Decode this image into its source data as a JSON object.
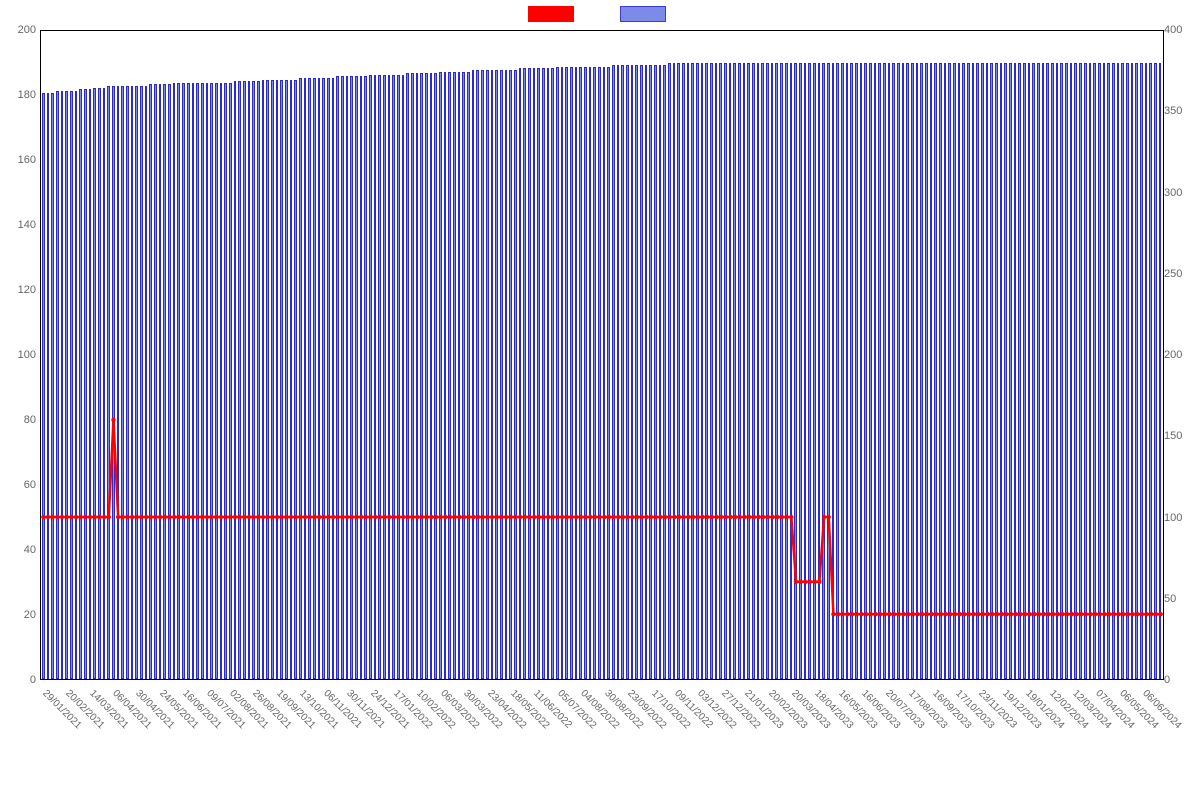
{
  "chart_data": {
    "type": "bar+line",
    "title": "",
    "xlabel": "",
    "y_left": {
      "label": "",
      "lim": [
        0,
        200
      ],
      "ticks": [
        0,
        20,
        40,
        60,
        80,
        100,
        120,
        140,
        160,
        180,
        200
      ]
    },
    "y_right": {
      "label": "",
      "lim": [
        0,
        400
      ],
      "ticks": [
        0,
        50,
        100,
        150,
        200,
        250,
        300,
        350,
        400
      ]
    },
    "x_tick_labels": [
      "29/01/2021",
      "20/02/2021",
      "14/03/2021",
      "06/04/2021",
      "30/04/2021",
      "24/05/2021",
      "16/06/2021",
      "09/07/2021",
      "02/08/2021",
      "26/08/2021",
      "19/09/2021",
      "13/10/2021",
      "06/11/2021",
      "30/11/2021",
      "24/12/2021",
      "17/01/2022",
      "10/02/2022",
      "06/03/2022",
      "30/03/2022",
      "23/04/2022",
      "18/05/2022",
      "11/06/2022",
      "05/07/2022",
      "04/08/2022",
      "30/08/2022",
      "23/09/2022",
      "17/10/2022",
      "09/11/2022",
      "03/12/2022",
      "27/12/2022",
      "21/01/2023",
      "20/02/2023",
      "20/03/2023",
      "18/04/2023",
      "16/05/2023",
      "16/06/2023",
      "20/07/2023",
      "17/08/2023",
      "16/09/2023",
      "17/10/2023",
      "23/11/2023",
      "19/12/2023",
      "19/01/2024",
      "12/02/2024",
      "12/03/2024",
      "07/04/2024",
      "06/05/2024",
      "06/06/2024"
    ],
    "series": [
      {
        "name": "",
        "axis": "left",
        "style": "line",
        "color": "#ff0000",
        "marker_every": 1,
        "values": [
          50,
          50,
          50,
          50,
          50,
          50,
          50,
          50,
          50,
          50,
          50,
          50,
          50,
          50,
          50,
          80,
          50,
          50,
          50,
          50,
          50,
          50,
          50,
          50,
          50,
          50,
          50,
          50,
          50,
          50,
          50,
          50,
          50,
          50,
          50,
          50,
          50,
          50,
          50,
          50,
          50,
          50,
          50,
          50,
          50,
          50,
          50,
          50,
          50,
          50,
          50,
          50,
          50,
          50,
          50,
          50,
          50,
          50,
          50,
          50,
          50,
          50,
          50,
          50,
          50,
          50,
          50,
          50,
          50,
          50,
          50,
          50,
          50,
          50,
          50,
          50,
          50,
          50,
          50,
          50,
          50,
          50,
          50,
          50,
          50,
          50,
          50,
          50,
          50,
          50,
          50,
          50,
          50,
          50,
          50,
          50,
          50,
          50,
          50,
          50,
          50,
          50,
          50,
          50,
          50,
          50,
          50,
          50,
          50,
          50,
          50,
          50,
          50,
          50,
          50,
          50,
          50,
          50,
          50,
          50,
          50,
          50,
          50,
          50,
          50,
          50,
          50,
          50,
          50,
          50,
          50,
          50,
          50,
          50,
          50,
          50,
          50,
          50,
          50,
          50,
          50,
          50,
          50,
          50,
          50,
          50,
          50,
          50,
          50,
          50,
          50,
          50,
          50,
          50,
          50,
          50,
          50,
          50,
          50,
          50,
          50,
          30,
          30,
          30,
          30,
          30,
          30,
          50,
          50,
          20,
          20,
          20,
          20,
          20,
          20,
          20,
          20,
          20,
          20,
          20,
          20,
          20,
          20,
          20,
          20,
          20,
          20,
          20,
          20,
          20,
          20,
          20,
          20,
          20,
          20,
          20,
          20,
          20,
          20,
          20,
          20,
          20,
          20,
          20,
          20,
          20,
          20,
          20,
          20,
          20,
          20,
          20,
          20,
          20,
          20,
          20,
          20,
          20,
          20,
          20,
          20,
          20,
          20,
          20,
          20,
          20,
          20,
          20,
          20,
          20,
          20,
          20,
          20,
          20,
          20,
          20,
          20,
          20,
          20,
          20
        ]
      },
      {
        "name": "",
        "axis": "right",
        "style": "bar",
        "color": "#7b8be6",
        "values": [
          362,
          362,
          362,
          363,
          363,
          363,
          363,
          363,
          364,
          364,
          364,
          365,
          365,
          365,
          366,
          366,
          366,
          366,
          366,
          366,
          366,
          366,
          366,
          367,
          367,
          367,
          367,
          367,
          368,
          368,
          368,
          368,
          368,
          368,
          368,
          368,
          368,
          368,
          368,
          368,
          368,
          369,
          369,
          369,
          369,
          369,
          369,
          370,
          370,
          370,
          370,
          370,
          370,
          370,
          370,
          371,
          371,
          371,
          371,
          371,
          371,
          371,
          371,
          372,
          372,
          372,
          372,
          372,
          372,
          372,
          373,
          373,
          373,
          373,
          373,
          373,
          373,
          373,
          374,
          374,
          374,
          374,
          374,
          374,
          374,
          375,
          375,
          375,
          375,
          375,
          375,
          375,
          376,
          376,
          376,
          376,
          376,
          376,
          376,
          376,
          376,
          376,
          377,
          377,
          377,
          377,
          377,
          377,
          377,
          377,
          378,
          378,
          378,
          378,
          378,
          378,
          378,
          378,
          378,
          378,
          378,
          378,
          379,
          379,
          379,
          379,
          379,
          379,
          379,
          379,
          379,
          379,
          379,
          379,
          380,
          380,
          380,
          380,
          380,
          380,
          380,
          380,
          380,
          380,
          380,
          380,
          380,
          380,
          380,
          380,
          380,
          380,
          380,
          380,
          380,
          380,
          380,
          380,
          380,
          380,
          380,
          380,
          380,
          380,
          380,
          380,
          380,
          380,
          380,
          380,
          380,
          380,
          380,
          380,
          380,
          380,
          380,
          380,
          380,
          380,
          380,
          380,
          380,
          380,
          380,
          380,
          380,
          380,
          380,
          380,
          380,
          380,
          380,
          380,
          380,
          380,
          380,
          380,
          380,
          380,
          380,
          380,
          380,
          380,
          380,
          380,
          380,
          380,
          380,
          380,
          380,
          380,
          380,
          380,
          380,
          380,
          380,
          380,
          380,
          380,
          380,
          380,
          380,
          380,
          380,
          380,
          380,
          380,
          380,
          380,
          380,
          380,
          380,
          380,
          380,
          380,
          380,
          380,
          380,
          380
        ]
      }
    ]
  }
}
